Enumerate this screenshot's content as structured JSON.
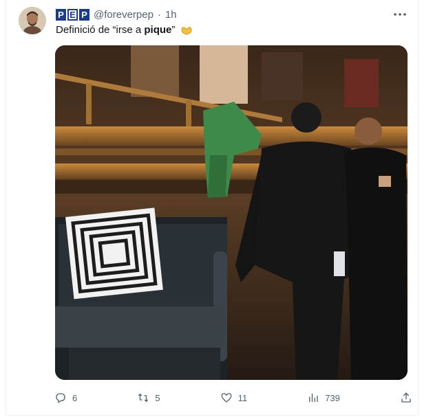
{
  "tweet": {
    "brand": [
      "P",
      "E",
      "P"
    ],
    "handle": "@foreverpep",
    "separator": "·",
    "time": "1h",
    "text_prefix": "Definició de “irse a ",
    "text_bold": "pique",
    "text_suffix": "”",
    "emoji": "heart-hands-emoji"
  },
  "actions": {
    "reply_count": "6",
    "retweet_count": "5",
    "like_count": "11",
    "views_count": "739"
  },
  "icons": {
    "more": "more-icon",
    "reply": "reply-icon",
    "retweet": "retweet-icon",
    "like": "heart-icon",
    "views": "views-icon",
    "share": "share-icon"
  },
  "colors": {
    "brand": "#1a3c8f",
    "muted": "#536471"
  }
}
